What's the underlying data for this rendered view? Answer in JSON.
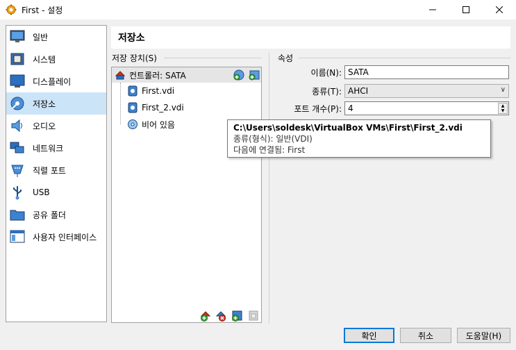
{
  "window": {
    "title": "First - 설정",
    "app_icon": "virtualbox-gear-icon",
    "controls": [
      "minimize-icon",
      "maximize-icon",
      "close-icon"
    ]
  },
  "sidebar": {
    "items": [
      {
        "label": "일반",
        "icon": "monitor-general-icon"
      },
      {
        "label": "시스템",
        "icon": "chip-icon"
      },
      {
        "label": "디스플레이",
        "icon": "display-icon"
      },
      {
        "label": "저장소",
        "icon": "disk-storage-icon",
        "selected": true
      },
      {
        "label": "오디오",
        "icon": "speaker-icon"
      },
      {
        "label": "네트워크",
        "icon": "network-icon"
      },
      {
        "label": "직렬 포트",
        "icon": "serial-port-icon"
      },
      {
        "label": "USB",
        "icon": "usb-icon"
      },
      {
        "label": "공유 폴더",
        "icon": "folder-icon"
      },
      {
        "label": "사용자 인터페이스",
        "icon": "ui-window-icon"
      }
    ]
  },
  "page": {
    "title": "저장소"
  },
  "storage": {
    "group_label": "저장 장치(S)",
    "controller": {
      "label": "컨트롤러: SATA"
    },
    "attachments": [
      {
        "label": "First.vdi",
        "icon": "hard-disk-icon"
      },
      {
        "label": "First_2.vdi",
        "icon": "hard-disk-icon"
      },
      {
        "label": "비어 있음",
        "icon": "optical-disc-icon"
      }
    ]
  },
  "attributes": {
    "group_label": "속성",
    "name_label": "이름(N):",
    "name_value": "SATA",
    "type_label": "종류(T):",
    "type_value": "AHCI",
    "ports_label": "포트 개수(P):",
    "ports_value": "4"
  },
  "tooltip": {
    "path": "C:\\Users\\soldesk\\VirtualBox VMs\\First\\First_2.vdi",
    "format": "종류(형식):  일반(VDI)",
    "attached": "다음에 연결됨: First"
  },
  "buttons": {
    "ok": "확인",
    "cancel": "취소",
    "help": "도움말(H)"
  },
  "colors": {
    "selection": "#cce4f7",
    "accent": "#0078d7",
    "add_green": "#3aa33a"
  }
}
